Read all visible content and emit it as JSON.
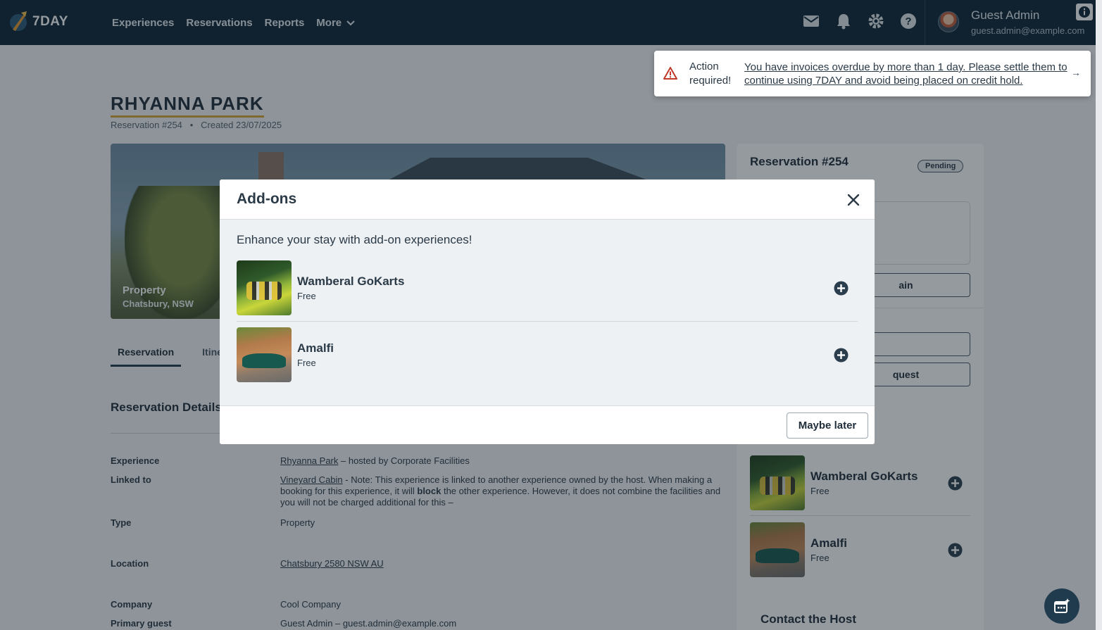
{
  "app": {
    "logo_text": "7DAY"
  },
  "nav": {
    "items": [
      "Experiences",
      "Reservations",
      "Reports",
      "More"
    ]
  },
  "user": {
    "name": "Guest Admin",
    "email": "guest.admin@example.com"
  },
  "alert": {
    "title": "Action required!",
    "message": "You have invoices overdue by more than 1 day. Please settle them to continue using 7DAY and avoid being placed on credit hold."
  },
  "page": {
    "title": "RHYANNA PARK",
    "reservation_no": "Reservation #254",
    "created": "Created 23/07/2025",
    "hero": {
      "label": "Property",
      "location": "Chatsbury, NSW"
    },
    "tabs": [
      "Reservation",
      "Itinera"
    ],
    "section_title": "Reservation Details",
    "details": {
      "experience_label": "Experience",
      "experience_link": "Rhyanna Park",
      "experience_rest": " – hosted by Corporate Facilities",
      "linked_label": "Linked to",
      "linked_link": "Vineyard Cabin",
      "linked_rest_1": " - Note: This experience is linked to another experience owned by the host. When making a booking for this experience, it will ",
      "linked_bold": "block",
      "linked_rest_2": " the other experience. However, it does not combine the facilities and you will not be charged additional for this –",
      "type_label": "Type",
      "type_value": "Property",
      "location_label": "Location",
      "location_value": "Chatsbury 2580 NSW AU",
      "company_label": "Company",
      "company_value": "Cool Company",
      "primary_label": "Primary guest",
      "primary_value": "Guest Admin – guest.admin@example.com"
    }
  },
  "side": {
    "title": "Reservation #254",
    "status": "Pending",
    "btn1_partial": "ain",
    "btn3_partial": "quest",
    "addons": [
      {
        "name": "Wamberal GoKarts",
        "price": "Free"
      },
      {
        "name": "Amalfi",
        "price": "Free"
      }
    ],
    "contact_title": "Contact the Host"
  },
  "modal": {
    "title": "Add-ons",
    "intro": "Enhance your stay with add-on experiences!",
    "addons": [
      {
        "name": "Wamberal GoKarts",
        "price": "Free"
      },
      {
        "name": "Amalfi",
        "price": "Free"
      }
    ],
    "dismiss_label": "Maybe later"
  },
  "colors": {
    "nav_bg": "#0d2535",
    "accent": "#d9a43a",
    "primary": "#1f3b4d",
    "warning": "#c0392b"
  }
}
